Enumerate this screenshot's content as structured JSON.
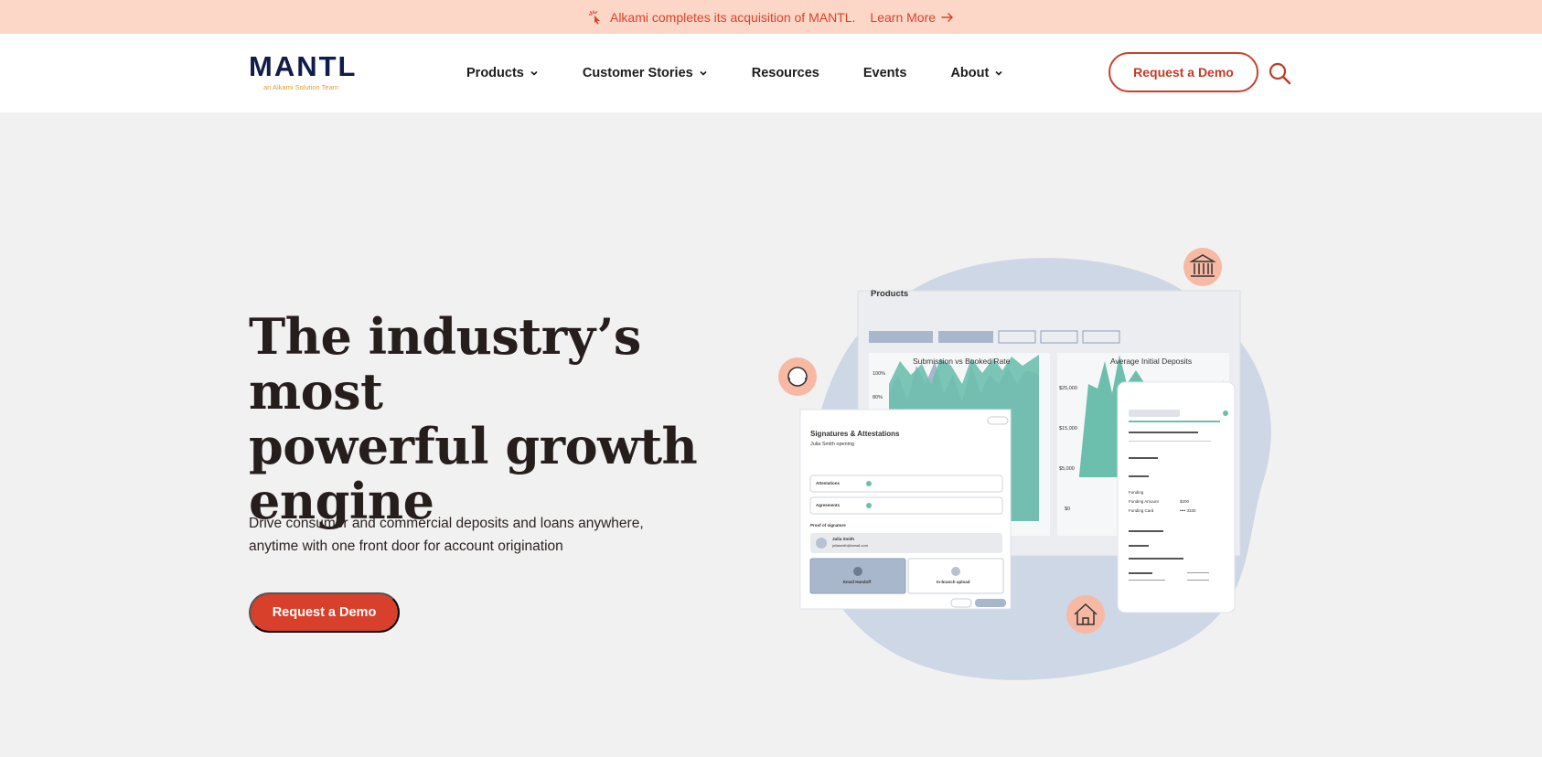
{
  "announcement": {
    "text": "Alkami completes its acquisition of MANTL.",
    "link_label": "Learn More"
  },
  "header": {
    "logo_text": "MANTL",
    "logo_sub": "an Alkami Solution Team",
    "nav": [
      {
        "label": "Products",
        "has_dropdown": true
      },
      {
        "label": "Customer Stories",
        "has_dropdown": true
      },
      {
        "label": "Resources",
        "has_dropdown": false
      },
      {
        "label": "Events",
        "has_dropdown": false
      },
      {
        "label": "About",
        "has_dropdown": true
      }
    ],
    "demo_label": "Request a Demo",
    "search_icon": "search-icon"
  },
  "hero": {
    "title_lines": [
      "The industry’s most",
      "powerful growth",
      "engine"
    ],
    "subtitle_lines": [
      "Drive consumer and commercial deposits and loans anywhere,",
      "anytime with one front door for account origination"
    ],
    "cta_label": "Request a Demo"
  },
  "illustration": {
    "products_label": "Products",
    "chart1_title": "Submission vs Booked Rate",
    "chart1_ticks": [
      "100%",
      "80%"
    ],
    "chart2_title": "Average Initial Deposits",
    "chart2_ticks": [
      "$25,000",
      "$15,000",
      "$5,000",
      "$0"
    ],
    "signatures_title": "Signatures & Attestations",
    "signatures_sub": "Julia Smith opening",
    "attestations": "Attestations",
    "agreements": "Agreements",
    "proof": "Proof of signature",
    "signer_name": "Julia Smith",
    "signer_email": "juliasmith@email.com",
    "email_handoff": "Email Handoff",
    "inbranch": "In-branch upload",
    "funding": "Funding",
    "funding_amount_label": "Funding Amount",
    "funding_amount": "$200",
    "funding_card_label": "Funding Card",
    "funding_card": "•••• 3330"
  },
  "colors": {
    "accent": "#d8402b",
    "announce_bg": "#fcd6c6",
    "navy": "#101c4a",
    "teal": "#6dbfad",
    "blob": "#cdd7e6"
  }
}
